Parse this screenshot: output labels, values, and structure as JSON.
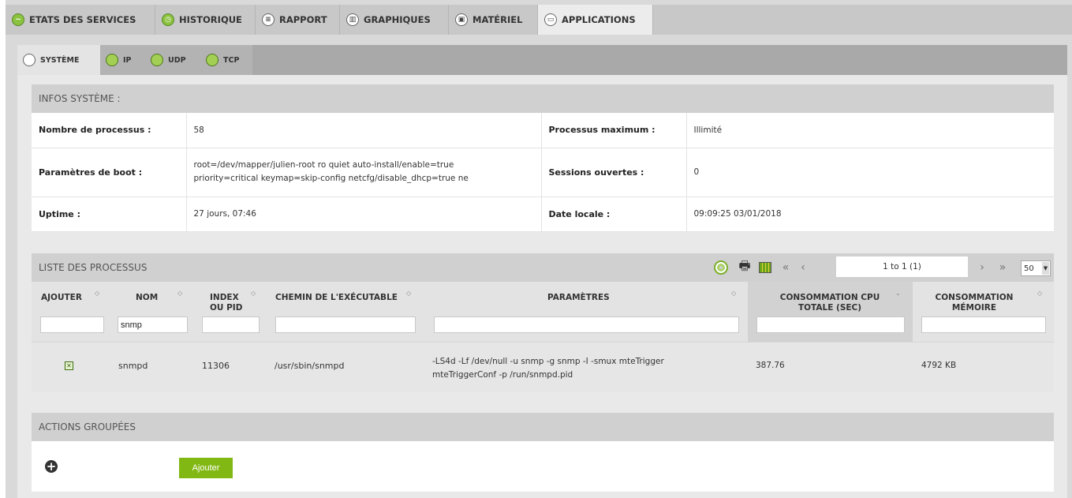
{
  "top_tabs": [
    {
      "label": "ETATS DES SERVICES",
      "icon": "heartbeat-icon"
    },
    {
      "label": "HISTORIQUE",
      "icon": "clock-icon"
    },
    {
      "label": "RAPPORT",
      "icon": "report-icon"
    },
    {
      "label": "GRAPHIQUES",
      "icon": "chart-icon"
    },
    {
      "label": "MATÉRIEL",
      "icon": "chip-icon"
    },
    {
      "label": "APPLICATIONS",
      "icon": "apps-icon",
      "active": true
    }
  ],
  "sub_tabs": [
    {
      "label": "SYSTÈME",
      "active": true
    },
    {
      "label": "IP"
    },
    {
      "label": "UDP"
    },
    {
      "label": "TCP"
    }
  ],
  "infos": {
    "title": "INFOS SYSTÈME :",
    "nb_processus_label": "Nombre de processus :",
    "nb_processus_value": "58",
    "proc_max_label": "Processus maximum :",
    "proc_max_value": "Illimité",
    "boot_label": "Paramètres de boot :",
    "boot_value_line1": "root=/dev/mapper/julien-root ro quiet auto-install/enable=true",
    "boot_value_line2": "priority=critical keymap=skip-config netcfg/disable_dhcp=true ne",
    "sessions_label": "Sessions ouvertes :",
    "sessions_value": "0",
    "uptime_label": "Uptime :",
    "uptime_value": "27 jours, 07:46",
    "date_label": "Date locale :",
    "date_value": "09:09:25 03/01/2018"
  },
  "processes": {
    "title": "LISTE DES PROCESSUS",
    "pager_text": "1 to 1 (1)",
    "page_size": "50",
    "columns": {
      "ajouter": "AJOUTER",
      "nom": "NOM",
      "index_l1": "INDEX",
      "index_l2": "OU PID",
      "chemin": "CHEMIN DE L'EXÉCUTABLE",
      "params": "PARAMÈTRES",
      "cpu_l1": "CONSOMMATION CPU",
      "cpu_l2": "TOTALE (SEC)",
      "mem_l1": "CONSOMMATION",
      "mem_l2": "MÉMOIRE"
    },
    "filter_nom": "snmp",
    "rows": [
      {
        "nom": "snmpd",
        "pid": "11306",
        "chemin": "/usr/sbin/snmpd",
        "params_l1": "-LS4d -Lf /dev/null -u snmp -g snmp -I -smux mteTrigger",
        "params_l2": "mteTriggerConf -p /run/snmpd.pid",
        "cpu": "387.76",
        "mem": "4792 KB"
      }
    ]
  },
  "actions": {
    "title": "ACTIONS GROUPÉES",
    "add_label": "Ajouter"
  }
}
